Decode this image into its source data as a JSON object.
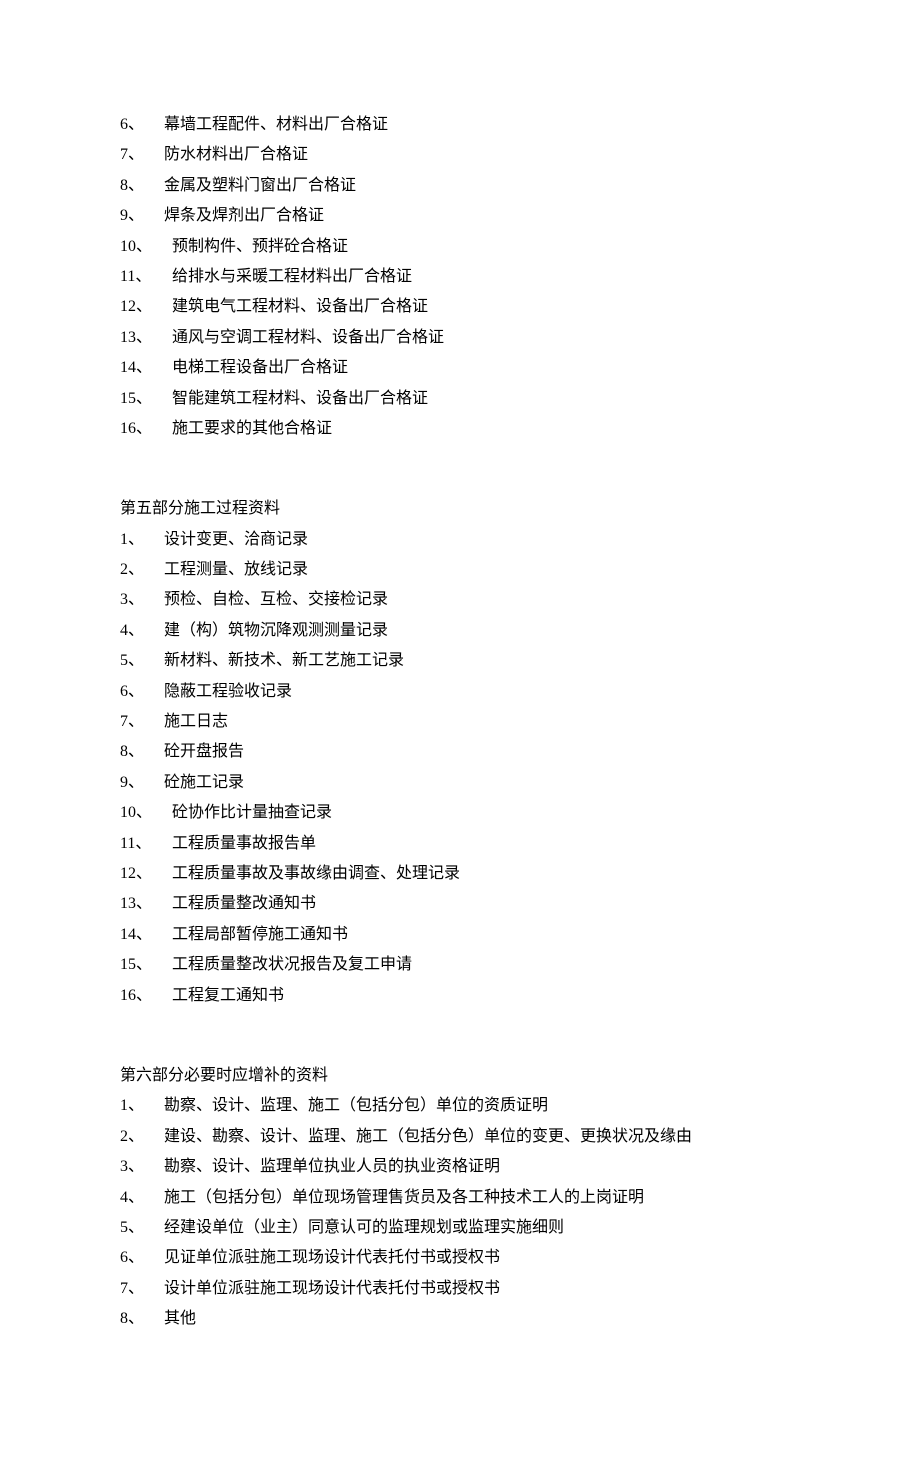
{
  "group1": {
    "items": [
      {
        "num": "6、",
        "text": "幕墙工程配件、材料出厂合格证"
      },
      {
        "num": "7、",
        "text": "防水材料出厂合格证"
      },
      {
        "num": "8、",
        "text": "金属及塑料门窗出厂合格证"
      },
      {
        "num": "9、",
        "text": "焊条及焊剂出厂合格证"
      },
      {
        "num": "10、",
        "text": "预制构件、预拌砼合格证"
      },
      {
        "num": "11、",
        "text": "给排水与采暖工程材料出厂合格证"
      },
      {
        "num": "12、",
        "text": "建筑电气工程材料、设备出厂合格证"
      },
      {
        "num": "13、",
        "text": "通风与空调工程材料、设备出厂合格证"
      },
      {
        "num": "14、",
        "text": "电梯工程设备出厂合格证"
      },
      {
        "num": "15、",
        "text": "智能建筑工程材料、设备出厂合格证"
      },
      {
        "num": "16、",
        "text": "施工要求的其他合格证"
      }
    ]
  },
  "section5": {
    "title": "第五部分施工过程资料",
    "items": [
      {
        "num": "1、",
        "text": "设计变更、洽商记录"
      },
      {
        "num": "2、",
        "text": "工程测量、放线记录"
      },
      {
        "num": "3、",
        "text": "预检、自检、互检、交接检记录"
      },
      {
        "num": "4、",
        "text": "建（构）筑物沉降观测测量记录"
      },
      {
        "num": "5、",
        "text": "新材料、新技术、新工艺施工记录"
      },
      {
        "num": "6、",
        "text": "隐蔽工程验收记录"
      },
      {
        "num": "7、",
        "text": "施工日志"
      },
      {
        "num": "8、",
        "text": "砼开盘报告"
      },
      {
        "num": "9、",
        "text": "砼施工记录"
      },
      {
        "num": "10、",
        "text": "砼协作比计量抽查记录"
      },
      {
        "num": "11、",
        "text": "工程质量事故报告单"
      },
      {
        "num": "12、",
        "text": "工程质量事故及事故缘由调查、处理记录"
      },
      {
        "num": "13、",
        "text": "工程质量整改通知书"
      },
      {
        "num": "14、",
        "text": "工程局部暂停施工通知书"
      },
      {
        "num": "15、",
        "text": "工程质量整改状况报告及复工申请"
      },
      {
        "num": "16、",
        "text": "工程复工通知书"
      }
    ]
  },
  "section6": {
    "title": "第六部分必要时应增补的资料",
    "items": [
      {
        "num": "1、",
        "text": "勘察、设计、监理、施工（包括分包）单位的资质证明"
      },
      {
        "num": "2、",
        "text": "建设、勘察、设计、监理、施工（包括分色）单位的变更、更换状况及缘由"
      },
      {
        "num": "3、",
        "text": "勘察、设计、监理单位执业人员的执业资格证明"
      },
      {
        "num": "4、",
        "text": "施工（包括分包）单位现场管理售货员及各工种技术工人的上岗证明"
      },
      {
        "num": "5、",
        "text": "经建设单位（业主）同意认可的监理规划或监理实施细则"
      },
      {
        "num": "6、",
        "text": "见证单位派驻施工现场设计代表托付书或授权书"
      },
      {
        "num": "7、",
        "text": "设计单位派驻施工现场设计代表托付书或授权书"
      },
      {
        "num": "8、",
        "text": "其他"
      }
    ]
  }
}
